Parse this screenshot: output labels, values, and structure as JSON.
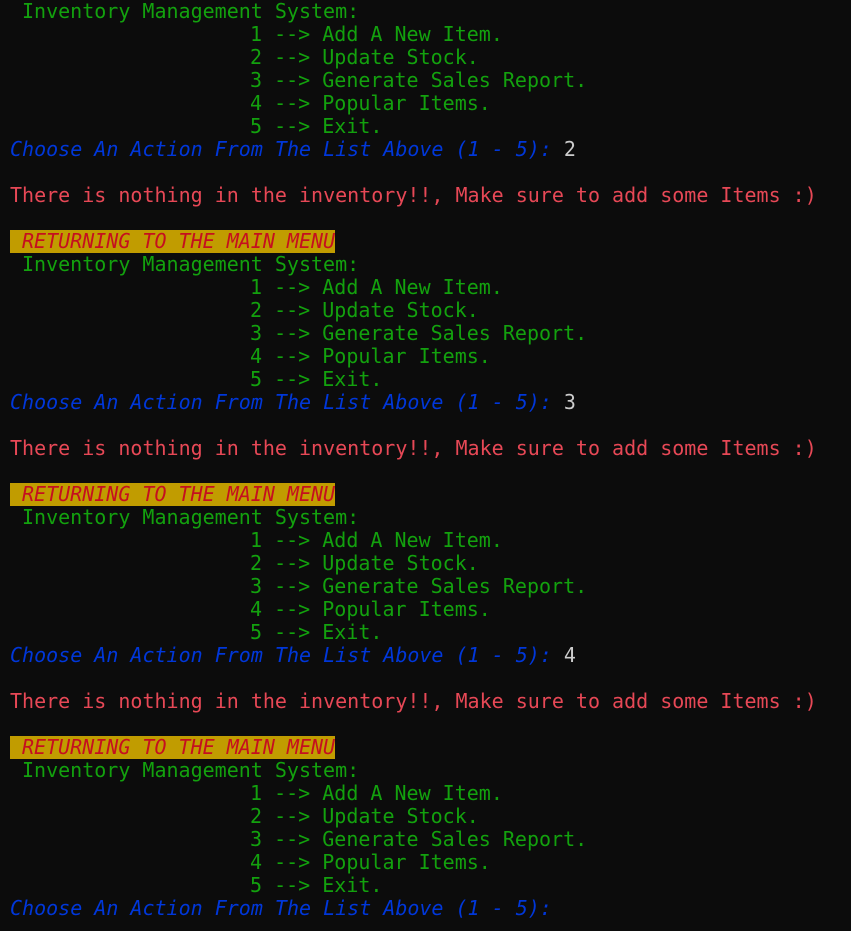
{
  "colors": {
    "background": "#0c0c0c",
    "menu_text": "#13a10e",
    "prompt_text": "#0037da",
    "input_text": "#cccccc",
    "error_text": "#e74856",
    "banner_background": "#c19c00",
    "banner_text": "#c50f1f"
  },
  "menu": {
    "title": "Inventory Management System:",
    "options": [
      {
        "number": "1",
        "arrow": "-->",
        "label": "Add A New Item."
      },
      {
        "number": "2",
        "arrow": "-->",
        "label": "Update Stock."
      },
      {
        "number": "3",
        "arrow": "-->",
        "label": "Generate Sales Report."
      },
      {
        "number": "4",
        "arrow": "-->",
        "label": "Popular Items."
      },
      {
        "number": "5",
        "arrow": "-->",
        "label": "Exit."
      }
    ]
  },
  "prompt": "Choose An Action From The List Above (1 - 5): ",
  "empty_inventory_message": "There is nothing in the inventory!!, Make sure to add some Items :)",
  "return_banner": "RETURNING TO THE MAIN MENU",
  "session": [
    {
      "input": "2"
    },
    {
      "input": "3"
    },
    {
      "input": "4"
    },
    {
      "input": ""
    }
  ]
}
